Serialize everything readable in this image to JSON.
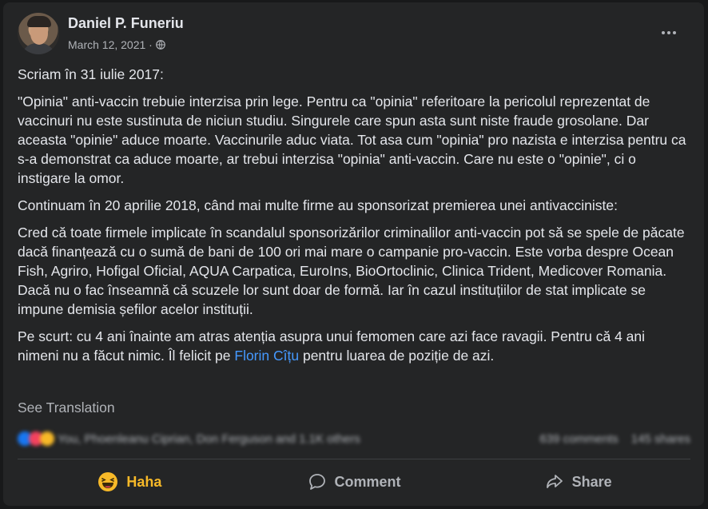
{
  "post": {
    "author": "Daniel P. Funeriu",
    "date": "March 12, 2021 · ",
    "privacy_icon": "globe-icon",
    "paragraphs": {
      "p1": "Scriam în 31 iulie 2017:",
      "p2": "\"Opinia\" anti-vaccin trebuie interzisa prin lege. Pentru ca \"opinia\" referitoare la pericolul reprezentat de vaccinuri nu este sustinuta de niciun studiu. Singurele care spun asta sunt niste fraude grosolane. Dar aceasta \"opinie\" aduce moarte. Vaccinurile aduc viata. Tot asa cum \"opinia\" pro nazista e interzisa pentru ca s-a demonstrat ca aduce moarte, ar trebui interzisa \"opinia\" anti-vaccin. Care nu este o \"opinie\", ci o instigare  la omor.",
      "p3": "Continuam în 20 aprilie 2018, când mai multe firme au sponsorizat premierea unei antivacciniste:",
      "p4": "Cred că toate firmele implicate în scandalul sponsorizărilor criminalilor anti-vaccin pot să se spele de păcate dacă finanțează cu o sumă de bani de 100 ori mai mare o campanie pro-vaccin. Este vorba despre Ocean Fish, Agriro, Hofigal Oficial, AQUA Carpatica, EuroIns, BioOrtoclinic, Clinica Trident, Medicover Romania. Dacă nu o fac înseamnă că scuzele lor sunt doar de formă. Iar în cazul instituțiilor de stat implicate se impune demisia șefilor acelor instituții.",
      "p5_before": "Pe scurt: cu 4 ani înainte am atras atenția asupra unui femomen care azi face ravagii. Pentru că 4 ani nimeni nu a făcut nimic. Îl felicit pe ",
      "p5_link": "Florin Cîțu",
      "p5_after": " pentru luarea de poziție de azi."
    },
    "see_translation": "See Translation"
  },
  "reactions": {
    "summary": "You, Phoenleanu Ciprian, Don Ferguson and 1.1K others",
    "comments": "639 comments",
    "shares": "145 shares",
    "colors": [
      "#1877f2",
      "#f3425f",
      "#f7b928"
    ]
  },
  "actions": {
    "haha": "Haha",
    "comment": "Comment",
    "share": "Share"
  },
  "colors": {
    "background": "#242526",
    "text": "#e4e6eb",
    "secondary": "#b0b3b8",
    "link": "#4599ff",
    "haha": "#f7b928"
  }
}
